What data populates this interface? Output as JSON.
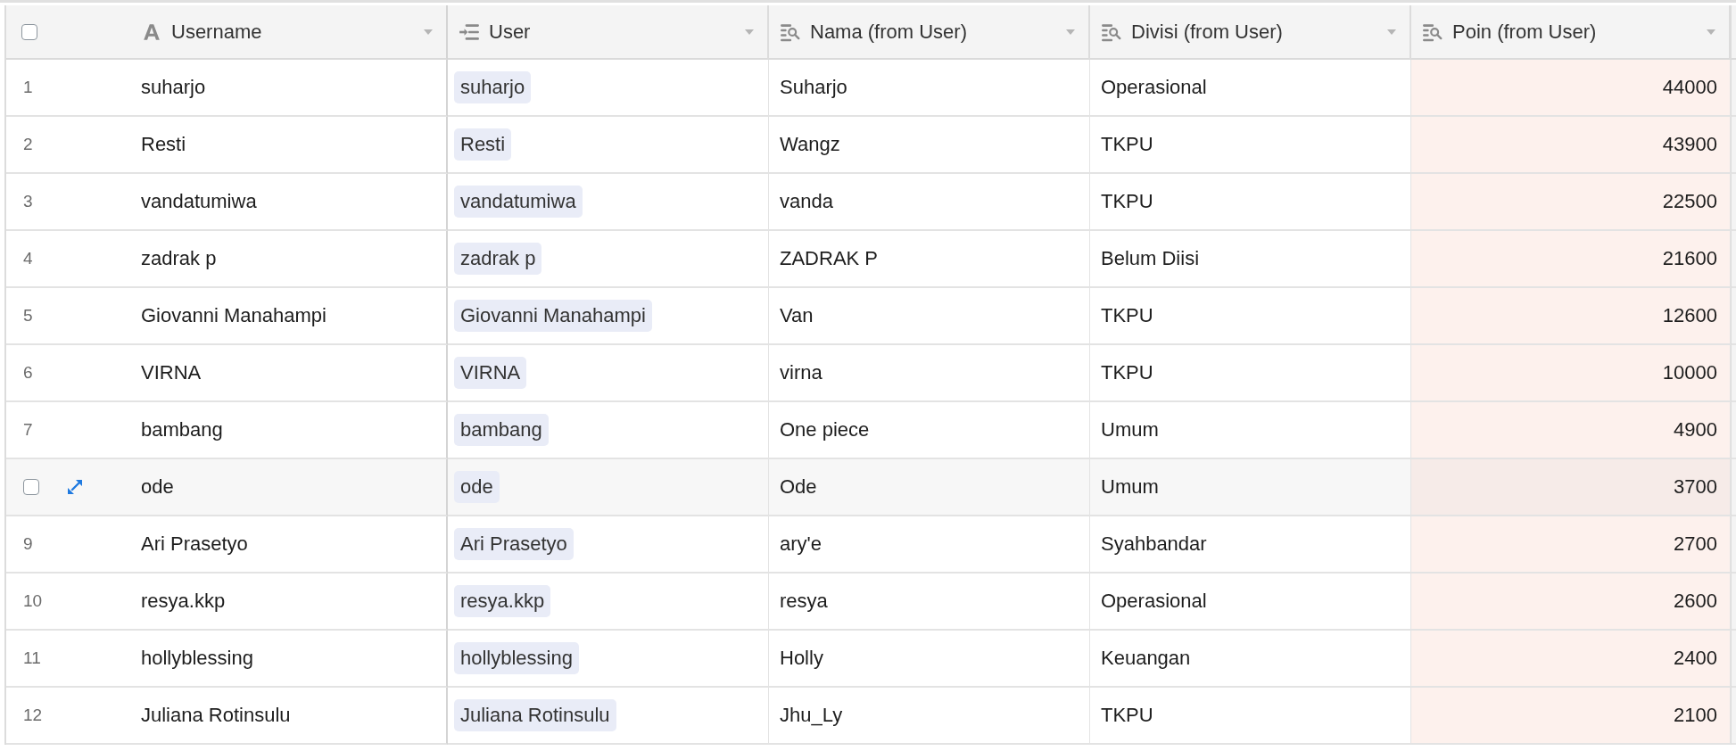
{
  "table": {
    "all_checked": false,
    "columns": [
      {
        "label": "Username",
        "kind": "text",
        "sorted": false
      },
      {
        "label": "User",
        "kind": "link",
        "sorted": false
      },
      {
        "label": "Nama (from User)",
        "kind": "lookup",
        "sorted": false
      },
      {
        "label": "Divisi (from User)",
        "kind": "lookup",
        "sorted": false
      },
      {
        "label": "Poin (from User)",
        "kind": "lookup_number",
        "sorted": true
      }
    ],
    "rows": [
      {
        "number": "1",
        "hovered": false,
        "cells": [
          "suharjo",
          "suharjo",
          "Suharjo",
          "Operasional",
          "44000"
        ]
      },
      {
        "number": "2",
        "hovered": false,
        "cells": [
          "Resti",
          "Resti",
          "Wangz",
          "TKPU",
          "43900"
        ]
      },
      {
        "number": "3",
        "hovered": false,
        "cells": [
          "vandatumiwa",
          "vandatumiwa",
          "vanda",
          "TKPU",
          "22500"
        ]
      },
      {
        "number": "4",
        "hovered": false,
        "cells": [
          "zadrak p",
          "zadrak p",
          "ZADRAK P",
          "Belum Diisi",
          "21600"
        ]
      },
      {
        "number": "5",
        "hovered": false,
        "cells": [
          "Giovanni Manahampi",
          "Giovanni Manahampi",
          "Van",
          "TKPU",
          "12600"
        ]
      },
      {
        "number": "6",
        "hovered": false,
        "cells": [
          "VIRNA",
          "VIRNA",
          "virna",
          "TKPU",
          "10000"
        ]
      },
      {
        "number": "7",
        "hovered": false,
        "cells": [
          "bambang",
          "bambang",
          "One piece",
          "Umum",
          "4900"
        ]
      },
      {
        "hovered": true,
        "checked": false,
        "cells": [
          "ode",
          "ode",
          "Ode",
          "Umum",
          "3700"
        ]
      },
      {
        "number": "9",
        "hovered": false,
        "cells": [
          "Ari Prasetyo",
          "Ari Prasetyo",
          "ary'e",
          "Syahbandar",
          "2700"
        ]
      },
      {
        "number": "10",
        "hovered": false,
        "cells": [
          "resya.kkp",
          "resya.kkp",
          "resya",
          "Operasional",
          "2600"
        ]
      },
      {
        "number": "11",
        "hovered": false,
        "cells": [
          "hollyblessing",
          "hollyblessing",
          "Holly",
          "Keuangan",
          "2400"
        ]
      },
      {
        "number": "12",
        "hovered": false,
        "cells": [
          "Juliana Rotinsulu",
          "Juliana Rotinsulu",
          "Jhu_Ly",
          "TKPU",
          "2100"
        ]
      }
    ]
  }
}
